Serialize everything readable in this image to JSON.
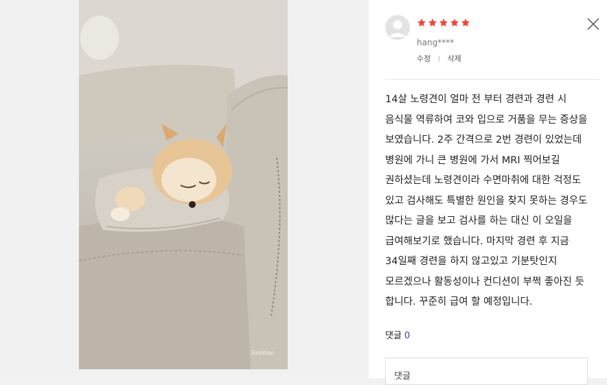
{
  "photo": {
    "watermark": "Seohae"
  },
  "review": {
    "rating": 5,
    "star_color": "#f0463c",
    "username": "hang****",
    "edit_label": "수정",
    "separator": "ㅣ",
    "delete_label": "삭제",
    "body": "14살 노령견이 얼마 전 부터 경련과 경련 시 음식물 역류하여 코와 입으로 거품을 무는 증상을 보였습니다. 2주 간격으로 2번 경련이 있었는데 병원에 가니 큰 병원에 가서 MRI 찍어보길 권하셨는데 노령견이라 수면마취에 대한 걱정도 있고 검사해도 특별한 원인을 찾지 못하는 경우도 많다는 글을 보고 검사를 하는 대신 이 오일을 급여해보기로 했습니다. 마지막 경련 후 지금 34일째 경련을 하지 않고있고 기분탓인지 모르겠으나 활동성이나 컨디션이 부쩍 좋아진 듯 합니다. 꾸준히 급여 할 예정입니다."
  },
  "comments": {
    "label": "댓글",
    "count": "0",
    "accent_color": "#5b2ea6",
    "input_placeholder": "댓글"
  },
  "icons": {
    "close": "close-icon",
    "avatar": "user-avatar-icon",
    "star": "star-icon"
  }
}
